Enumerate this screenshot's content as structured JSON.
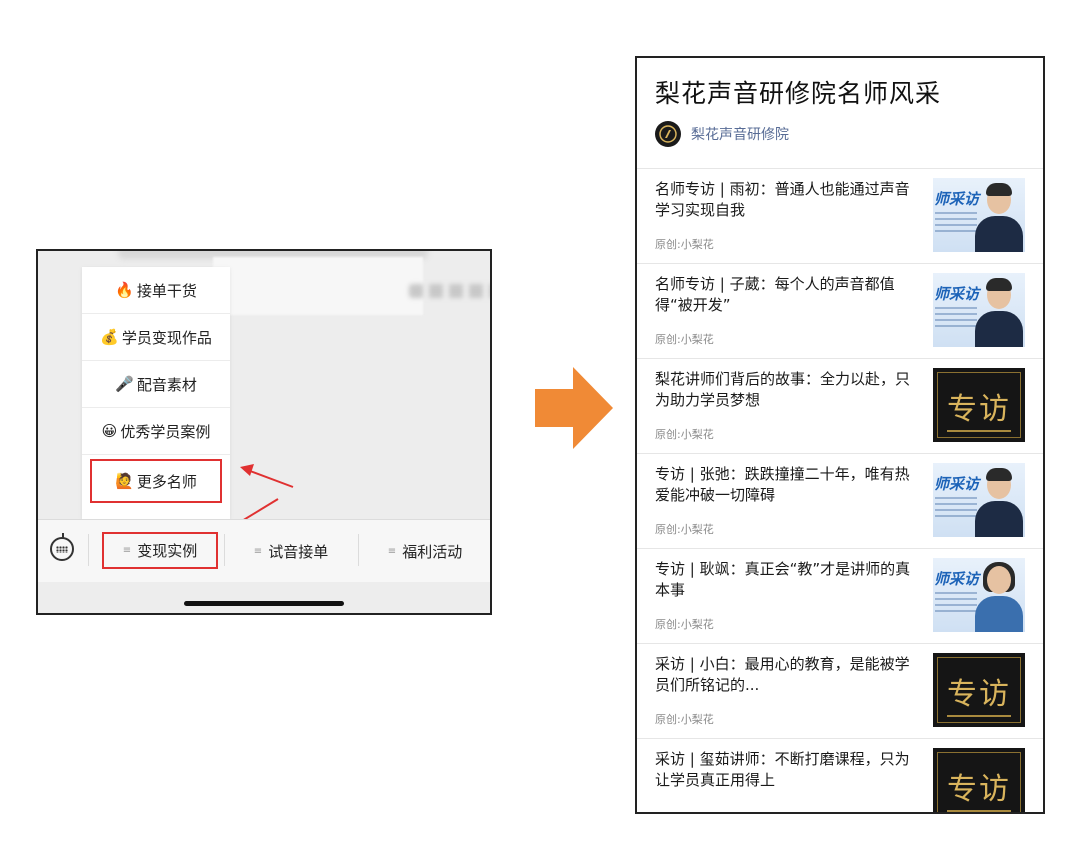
{
  "left": {
    "menu_items": [
      {
        "emoji": "🔥",
        "label": "接单干货"
      },
      {
        "emoji": "💰",
        "label": "学员变现作品"
      },
      {
        "emoji": "🎤",
        "label": "配音素材"
      },
      {
        "emoji": "😀",
        "label": "优秀学员案例"
      },
      {
        "emoji": "🙋",
        "label": "更多名师"
      }
    ],
    "tabs": [
      {
        "label": "变现实例"
      },
      {
        "label": "试音接单"
      },
      {
        "label": "福利活动"
      }
    ],
    "keyboard_icon": "keyboard-icon",
    "highlight_color": "#e03131"
  },
  "arrow_color": "#f08a36",
  "right": {
    "title": "梨花声音研修院名师风采",
    "account_name": "梨花声音研修院",
    "articles": [
      {
        "title": "名师专访 | 雨初：普通人也能通过声音学习实现自我",
        "meta": "原创:小梨花",
        "thumb_caption": "师采访"
      },
      {
        "title": "名师专访 | 子葳：每个人的声音都值得“被开发”",
        "meta": "原创:小梨花",
        "thumb_caption": "师采访"
      },
      {
        "title": "梨花讲师们背后的故事：全力以赴，只为助力学员梦想",
        "meta": "原创:小梨花",
        "thumb_caption": "专访"
      },
      {
        "title": "专访 | 张弛：跌跌撞撞二十年，唯有热爱能冲破一切障碍",
        "meta": "原创:小梨花",
        "thumb_caption": "师采访"
      },
      {
        "title": "专访 | 耿飒：真正会“教”才是讲师的真本事",
        "meta": "原创:小梨花",
        "thumb_caption": "师采访"
      },
      {
        "title": "采访 | 小白：最用心的教育，是能被学员们所铭记的...",
        "meta": "原创:小梨花",
        "thumb_caption": "专访"
      },
      {
        "title": "采访 | 玺茹讲师：不断打磨课程，只为让学员真正用得上",
        "meta": "",
        "thumb_caption": "专访"
      }
    ]
  }
}
